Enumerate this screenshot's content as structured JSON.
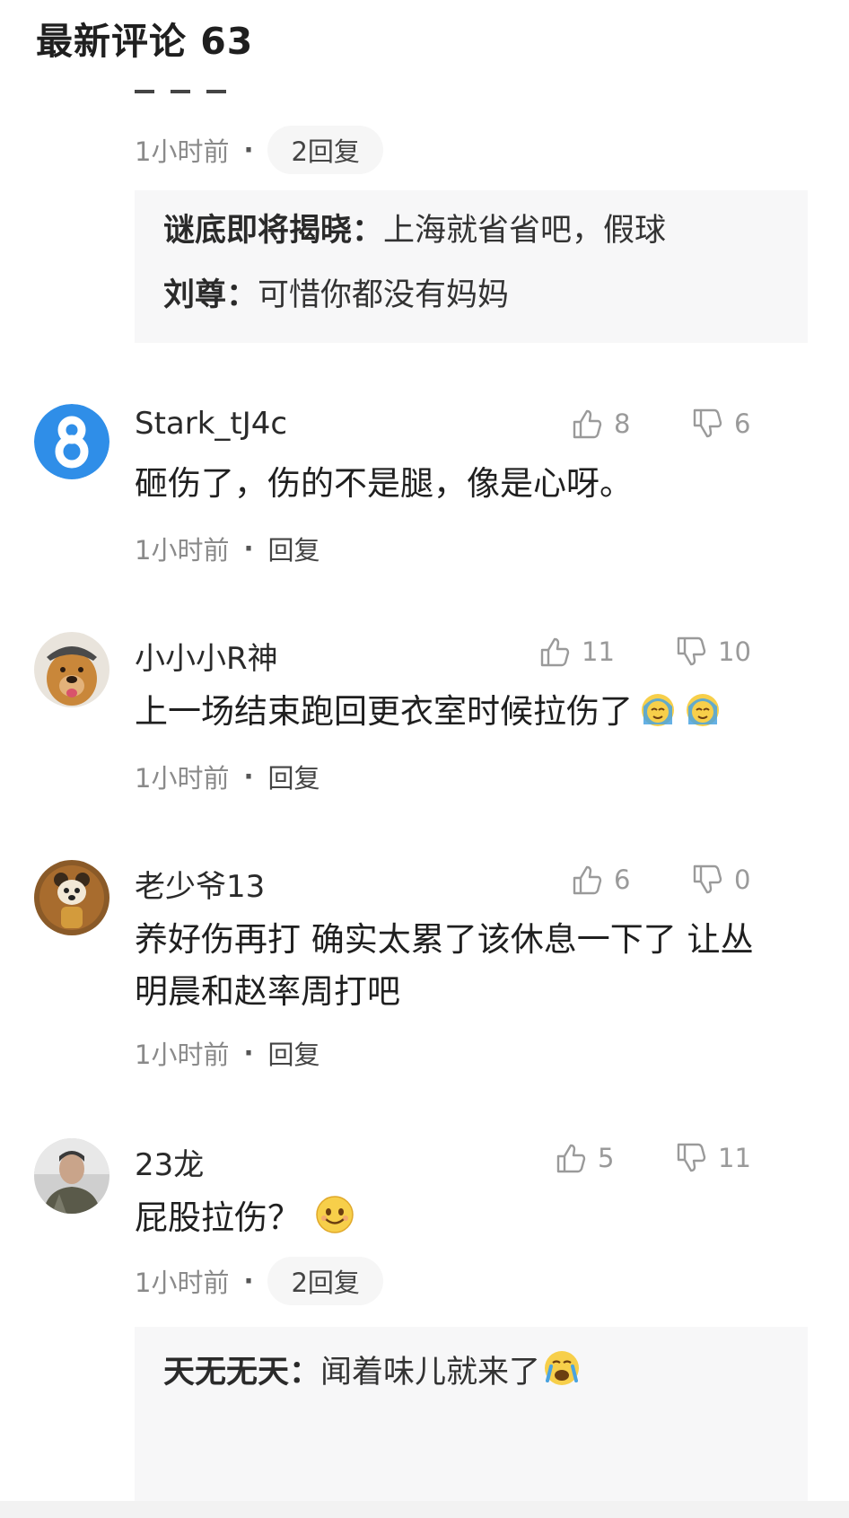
{
  "header": {
    "title": "最新评论 63"
  },
  "top_thread": {
    "time": "1小时前",
    "reply_count": "2回复",
    "replies": [
      {
        "name": "谜底即将揭晓",
        "text": "上海就省省吧，假球"
      },
      {
        "name": "刘尊",
        "text": "可惜你都没有妈妈"
      }
    ]
  },
  "comments": [
    {
      "username": "Stark_tJ4c",
      "likes": "8",
      "dislikes": "6",
      "text": "砸伤了，伤的不是腿，像是心呀。",
      "time": "1小时前",
      "reply": "回复",
      "avatar_icon": "number-8-icon"
    },
    {
      "username": "小小小R神",
      "likes": "11",
      "dislikes": "10",
      "text": "上一场结束跑回更衣室时候拉伤了",
      "time": "1小时前",
      "reply": "回复",
      "avatar_icon": "dog-avatar-icon",
      "emoji": [
        "crying-emoji-icon",
        "crying-emoji-icon"
      ]
    },
    {
      "username": "老少爷13",
      "likes": "6",
      "dislikes": "0",
      "text": "养好伤再打 确实太累了该休息一下了 让丛明晨和赵率周打吧",
      "time": "1小时前",
      "reply": "回复",
      "avatar_icon": "bear-avatar-icon"
    },
    {
      "username": "23龙",
      "likes": "5",
      "dislikes": "11",
      "text": "屁股拉伤？",
      "time": "1小时前",
      "reply": "2回复",
      "avatar_icon": "person-avatar-icon",
      "emoji": [
        "smile-emoji-icon"
      ]
    }
  ],
  "bottom_reply": {
    "name": "天无无天",
    "text": "闻着味儿就来了",
    "emoji": "crying-emoji-icon"
  },
  "separator": "：",
  "dot": "·",
  "colors": {
    "accent_blue": "#2f8ee8",
    "meta_gray": "#8a8a8a",
    "reply_bg": "#f7f7f8"
  }
}
